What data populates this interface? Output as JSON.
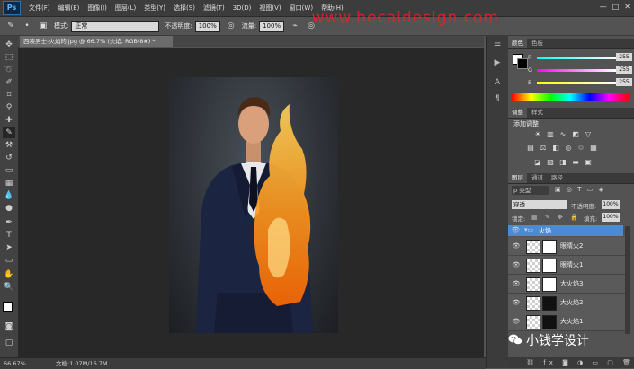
{
  "app": {
    "logo": "Ps",
    "window_controls": [
      "—",
      "□",
      "✕"
    ]
  },
  "menu": [
    "文件(F)",
    "编辑(E)",
    "图像(I)",
    "图层(L)",
    "类型(Y)",
    "选择(S)",
    "滤镜(T)",
    "3D(D)",
    "视图(V)",
    "窗口(W)",
    "帮助(H)"
  ],
  "options": {
    "mode_label": "模式:",
    "mode_value": "正常",
    "opacity_label": "不透明度:",
    "opacity_value": "100%",
    "flow_label": "流量:",
    "flow_value": "100%"
  },
  "watermark": "www.hecaidesign.com",
  "document": {
    "tab_title": "西装男士-火焰的.jpg @ 66.7% (火焰, RGB/8#) *",
    "close": "×"
  },
  "status": {
    "zoom": "66.67%",
    "doc_info": "文档:1.07M/16.7M"
  },
  "color_panel": {
    "tabs": [
      "颜色",
      "色板"
    ],
    "channels": [
      {
        "label": "R",
        "value": "255"
      },
      {
        "label": "G",
        "value": "255"
      },
      {
        "label": "B",
        "value": "255"
      }
    ]
  },
  "adjust_panel": {
    "tabs": [
      "调整",
      "样式"
    ],
    "title": "添加调整"
  },
  "layers_panel": {
    "tabs": [
      "图层",
      "通道",
      "路径"
    ],
    "filter_label": "ρ 类型",
    "blend_mode": "穿透",
    "opacity_label": "不透明度:",
    "opacity_value": "100%",
    "lock_label": "锁定:",
    "fill_label": "填充:",
    "fill_value": "100%",
    "group_name": "火焰",
    "layers": [
      "眼睛火2",
      "眼睛火1",
      "大火焰3",
      "大火焰2",
      "大火焰1"
    ]
  },
  "brand": "小钱学设计",
  "colors": {
    "accent": "#4b8bd4",
    "menu_bg": "#3c3c3c",
    "panel_bg": "#535353",
    "canvas_bg": "#282828",
    "watermark": "#e0242a"
  },
  "icons": [
    "move-icon",
    "marquee-icon",
    "lasso-icon",
    "quick-select-icon",
    "crop-icon",
    "eyedropper-icon",
    "healing-icon",
    "brush-icon",
    "stamp-icon",
    "history-brush-icon",
    "eraser-icon",
    "gradient-icon",
    "blur-icon",
    "dodge-icon",
    "pen-icon",
    "type-icon",
    "path-select-icon",
    "shape-icon",
    "hand-icon",
    "zoom-icon",
    "eye-icon",
    "folder-icon",
    "wechat-icon"
  ]
}
